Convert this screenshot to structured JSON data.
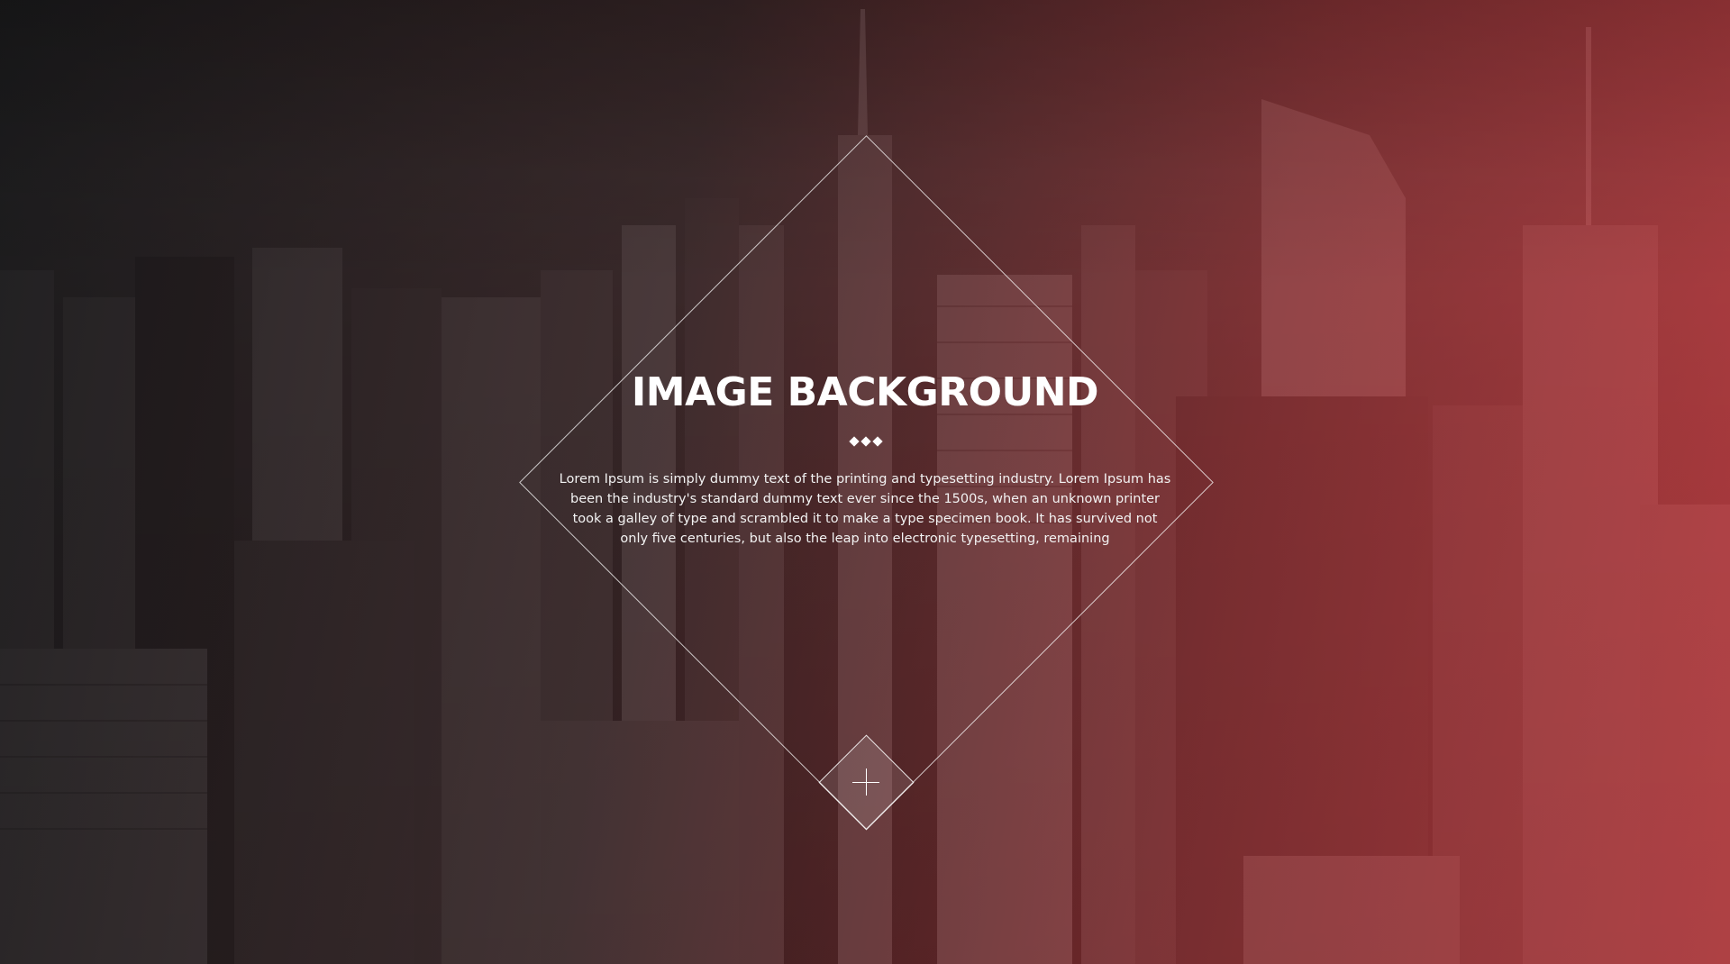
{
  "hero": {
    "title": "IMAGE BACKGROUND",
    "body": "Lorem Ipsum is simply dummy text of the printing and typesetting industry. Lorem Ipsum has been the industry's standard dummy text ever since the 1500s, when an unknown printer took a galley of type and scrambled it to make a type specimen book. It has survived not only five centuries, but also the leap into electronic typesetting, remaining",
    "divider_icon": "diamond-dots-icon",
    "action_icon": "plus-icon"
  },
  "colors": {
    "overlay_left": "#141416",
    "overlay_right": "#e14146",
    "text": "#ffffff"
  }
}
